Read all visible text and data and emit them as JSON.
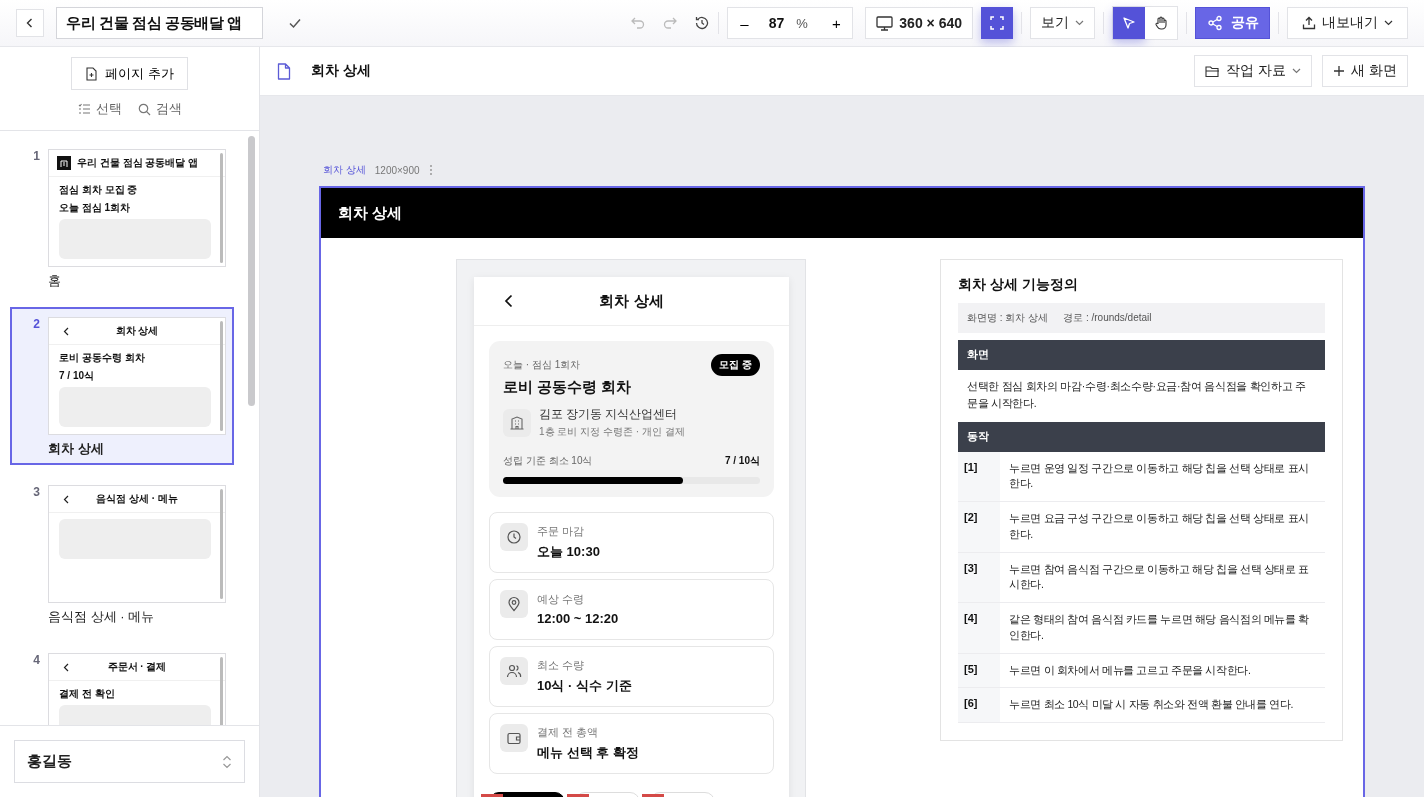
{
  "toolbar": {
    "project_title": "우리 건물 점심 공동배달 앱",
    "zoom": {
      "minus": "–",
      "value": "87",
      "unit": "%",
      "plus": "+"
    },
    "device": "360 × 640",
    "fit_active": true,
    "view": "보기",
    "tools": [
      {
        "kind": "select",
        "selected": true
      },
      {
        "kind": "hand",
        "selected": false
      }
    ],
    "share": "공유",
    "export": "내보내기"
  },
  "sidebar": {
    "add_page": "페이지 추가",
    "actions": [
      {
        "kind": "select",
        "label": "선택"
      },
      {
        "kind": "search",
        "label": "검색"
      }
    ],
    "pages": [
      {
        "number": "1",
        "label": "홈",
        "selected": false,
        "thumb": {
          "kind": "home",
          "title": "우리 건물 점심 공동배달 앱",
          "lines": [
            "점심 회차 모집 중",
            "오늘 점심 1회차"
          ]
        }
      },
      {
        "number": "2",
        "label": "회차 상세",
        "selected": true,
        "thumb": {
          "kind": "detail",
          "title": "회차 상세",
          "lines": [
            "로비 공동수령 회차",
            "7 / 10식"
          ]
        }
      },
      {
        "number": "3",
        "label": "음식점 상세 · 메뉴",
        "selected": false,
        "thumb": {
          "kind": "detail",
          "title": "음식점 상세 · 메뉴"
        }
      },
      {
        "number": "4",
        "selected": false,
        "thumb": {
          "kind": "detail",
          "title": "주문서 · 결제",
          "lines": [
            "결제 전 확인"
          ]
        }
      }
    ],
    "user": "홍길동"
  },
  "page_header": {
    "title": "회차 상세",
    "work_files": "작업 자료",
    "new_screen": "새 화면"
  },
  "frame": {
    "label": "회차 상세",
    "size": "1200×900",
    "header": "회차 상세"
  },
  "phone": {
    "title": "회차 상세",
    "summary": {
      "eyebrow": "오늘 · 점심 1회차",
      "badge": "모집 중",
      "title": "로비 공동수령 회차",
      "place": "김포 장기동 지식산업센터",
      "place_detail": "1층 로비 지정 수령존 · 개인 결제",
      "progress_label": "성립 기준 최소 10식",
      "count": "7 / 10식",
      "level": 0.7
    },
    "info": [
      {
        "kind": "clock",
        "label": "주문 마감",
        "value": "오늘 10:30"
      },
      {
        "kind": "pin",
        "label": "예상 수령",
        "value": "12:00 ~ 12:20"
      },
      {
        "kind": "people",
        "label": "최소 수량",
        "value": "10식 · 식수 기준"
      },
      {
        "kind": "wallet",
        "label": "결제 전 총액",
        "value": "메뉴 선택 후 확정"
      }
    ],
    "chips": [
      {
        "selected": true
      },
      {
        "selected": false
      },
      {
        "selected": false
      }
    ]
  },
  "spec": {
    "title": "회차 상세 기능정의",
    "screen_name": "화면명 : 회차 상세",
    "path": "경로 : /rounds/detail",
    "sections": [
      {
        "kind": "text",
        "heading": "화면",
        "text": "선택한 점심 회차의 마감·수령·최소수량·요금·참여 음식점을 확인하고 주문을 시작한다."
      },
      {
        "kind": "actions",
        "heading": "동작",
        "rows": [
          {
            "number": "[1]",
            "text": "누르면 운영 일정 구간으로 이동하고 해당 칩을 선택 상태로 표시한다."
          },
          {
            "number": "[2]",
            "text": "누르면 요금 구성 구간으로 이동하고 해당 칩을 선택 상태로 표시한다."
          },
          {
            "number": "[3]",
            "text": "누르면 참여 음식점 구간으로 이동하고 해당 칩을 선택 상태로 표시한다."
          },
          {
            "number": "[4]",
            "text": "같은 형태의 참여 음식점 카드를 누르면 해당 음식점의 메뉴를 확인한다."
          },
          {
            "number": "[5]",
            "text": "누르면 이 회차에서 메뉴를 고르고 주문을 시작한다."
          },
          {
            "number": "[6]",
            "text": "누르면 최소 10식 미달 시 자동 취소와 전액 환불 안내를 연다."
          }
        ]
      }
    ]
  }
}
